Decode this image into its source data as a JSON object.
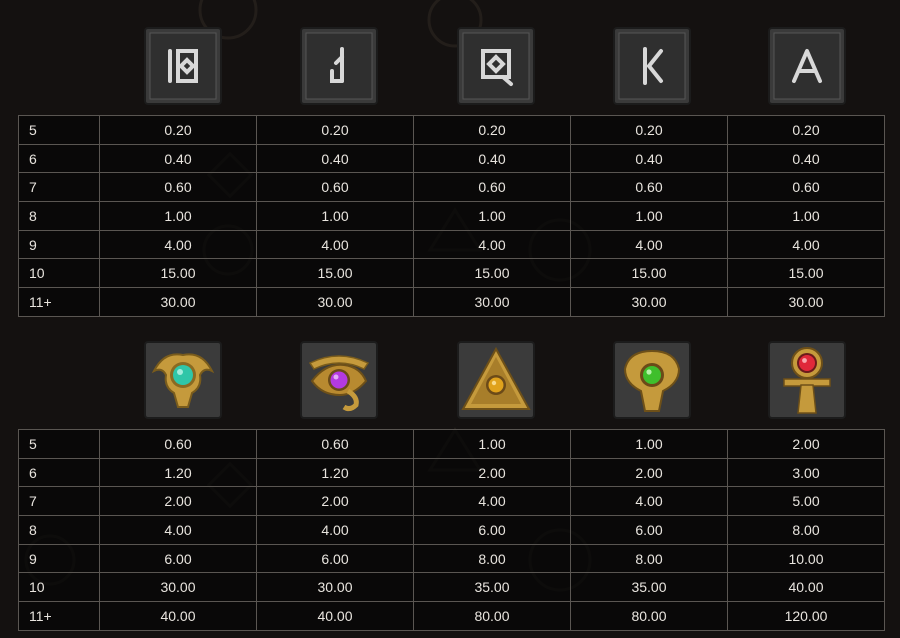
{
  "sections": [
    {
      "symbols": [
        {
          "name": "ten-rune-icon",
          "color": "#cfcfcf"
        },
        {
          "name": "jack-rune-icon",
          "color": "#cfcfcf"
        },
        {
          "name": "queen-rune-icon",
          "color": "#cfcfcf"
        },
        {
          "name": "king-rune-icon",
          "color": "#cfcfcf"
        },
        {
          "name": "ace-rune-icon",
          "color": "#cfcfcf"
        }
      ],
      "rows": [
        {
          "count": "5",
          "values": [
            "0.20",
            "0.20",
            "0.20",
            "0.20",
            "0.20"
          ]
        },
        {
          "count": "6",
          "values": [
            "0.40",
            "0.40",
            "0.40",
            "0.40",
            "0.40"
          ]
        },
        {
          "count": "7",
          "values": [
            "0.60",
            "0.60",
            "0.60",
            "0.60",
            "0.60"
          ]
        },
        {
          "count": "8",
          "values": [
            "1.00",
            "1.00",
            "1.00",
            "1.00",
            "1.00"
          ]
        },
        {
          "count": "9",
          "values": [
            "4.00",
            "4.00",
            "4.00",
            "4.00",
            "4.00"
          ]
        },
        {
          "count": "10",
          "values": [
            "15.00",
            "15.00",
            "15.00",
            "15.00",
            "15.00"
          ]
        },
        {
          "count": "11+",
          "values": [
            "30.00",
            "30.00",
            "30.00",
            "30.00",
            "30.00"
          ]
        }
      ]
    },
    {
      "symbols": [
        {
          "name": "scarab-teal-gem-icon",
          "color": "#2fc6a8"
        },
        {
          "name": "eye-of-horus-purple-gem-icon",
          "color": "#b43ae0"
        },
        {
          "name": "pyramid-amber-gem-icon",
          "color": "#e0a21c"
        },
        {
          "name": "cobra-green-gem-icon",
          "color": "#3fbf2c"
        },
        {
          "name": "ankh-red-gem-icon",
          "color": "#e0283a"
        }
      ],
      "rows": [
        {
          "count": "5",
          "values": [
            "0.60",
            "0.60",
            "1.00",
            "1.00",
            "2.00"
          ]
        },
        {
          "count": "6",
          "values": [
            "1.20",
            "1.20",
            "2.00",
            "2.00",
            "3.00"
          ]
        },
        {
          "count": "7",
          "values": [
            "2.00",
            "2.00",
            "4.00",
            "4.00",
            "5.00"
          ]
        },
        {
          "count": "8",
          "values": [
            "4.00",
            "4.00",
            "6.00",
            "6.00",
            "8.00"
          ]
        },
        {
          "count": "9",
          "values": [
            "6.00",
            "6.00",
            "8.00",
            "8.00",
            "10.00"
          ]
        },
        {
          "count": "10",
          "values": [
            "30.00",
            "30.00",
            "35.00",
            "35.00",
            "40.00"
          ]
        },
        {
          "count": "11+",
          "values": [
            "40.00",
            "40.00",
            "80.00",
            "80.00",
            "120.00"
          ]
        }
      ]
    }
  ],
  "theme": {
    "background": "#141110",
    "border": "#5a5652",
    "gold": "#c9a24a",
    "stone": "#3b3b3b"
  }
}
